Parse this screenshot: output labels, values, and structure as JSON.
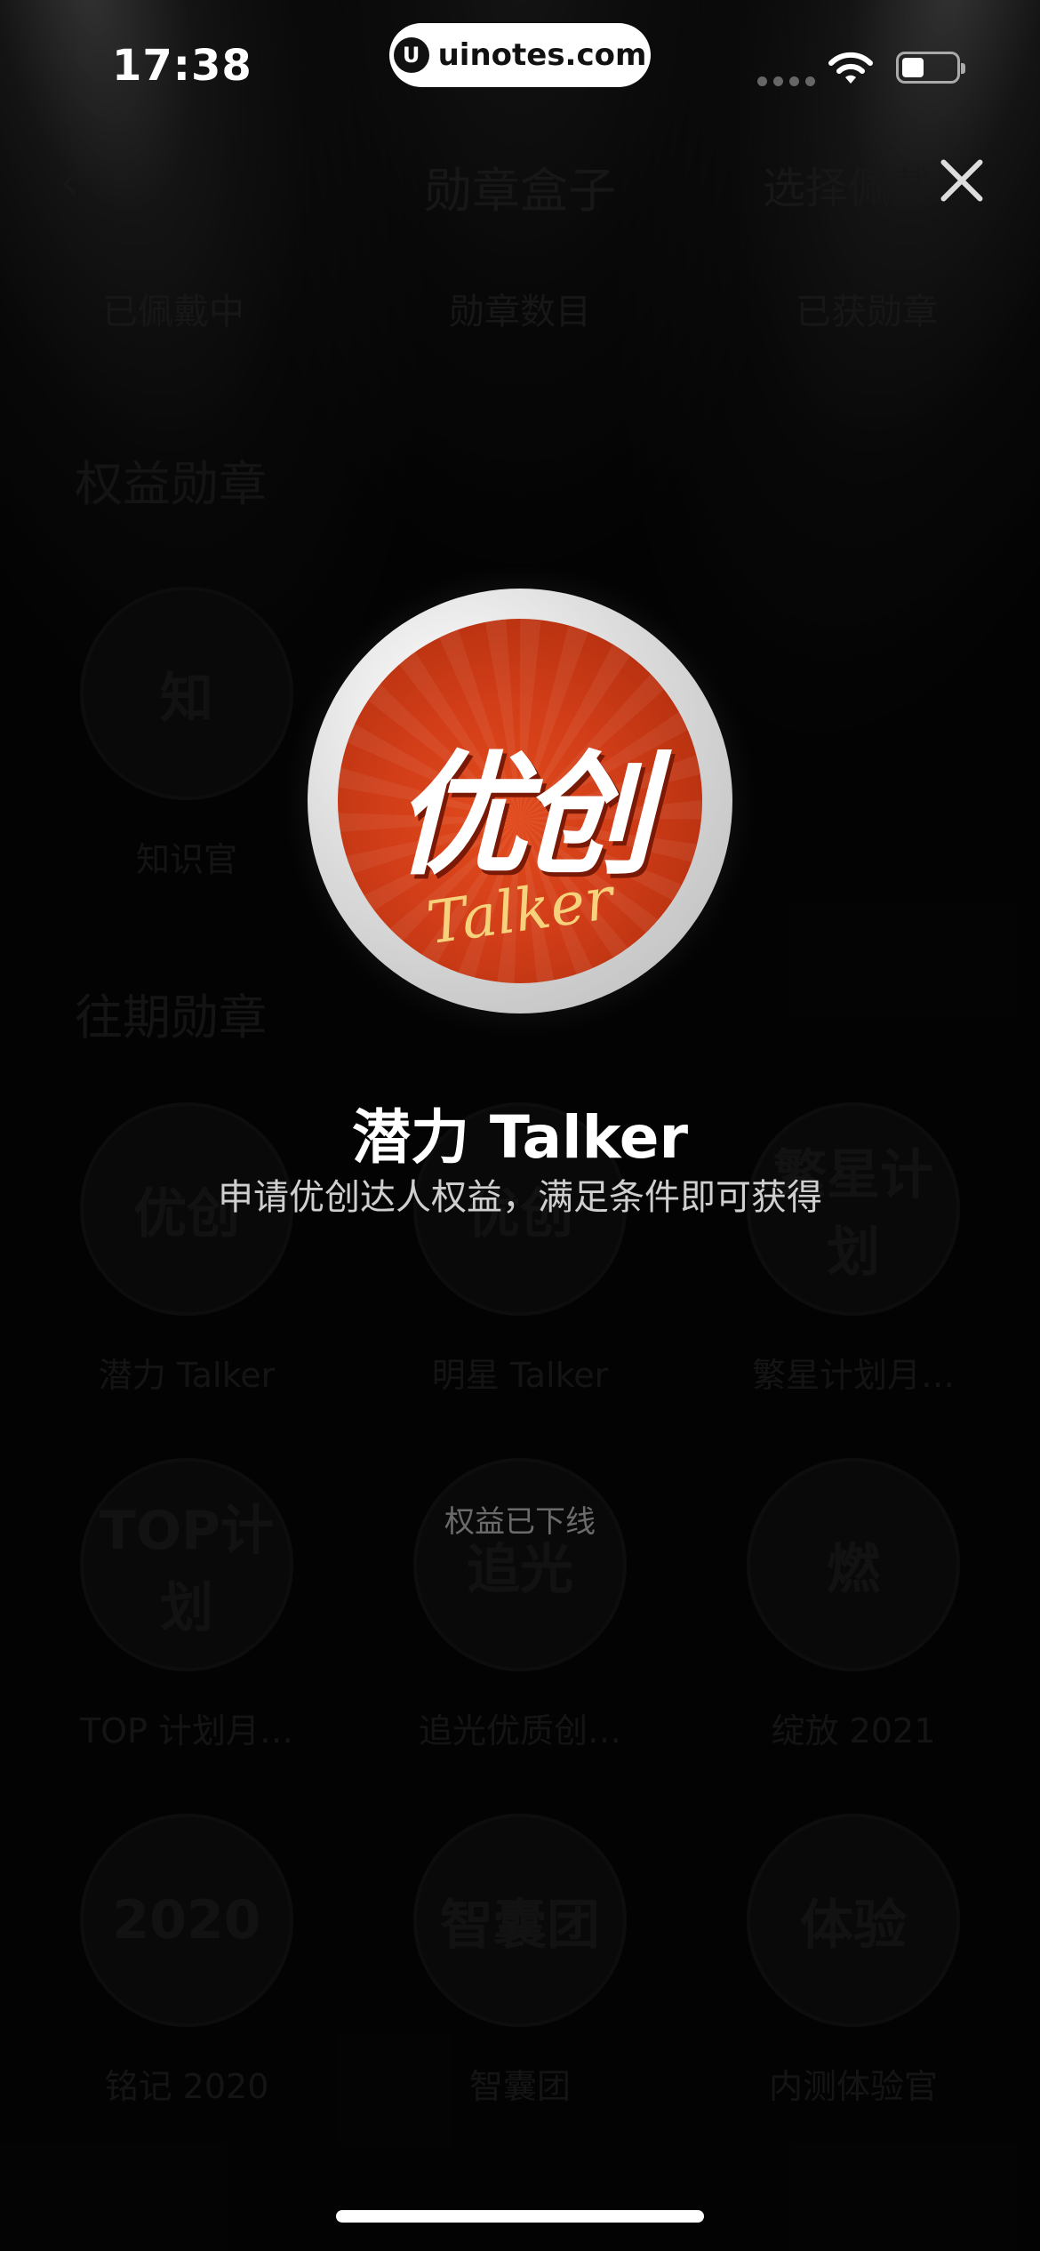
{
  "status_bar": {
    "time": "17:38",
    "url": "uinotes.com",
    "url_logo": "U"
  },
  "background_page": {
    "nav": {
      "back_icon": "‹",
      "title": "勋章盒子",
      "right_action": "选择佩戴"
    },
    "stats": [
      "已佩戴中",
      "勋章数目",
      "已获勋章"
    ],
    "sections": {
      "rights": "权益勋章",
      "past": "往期勋章"
    },
    "rights_badges": [
      {
        "label": "知识官",
        "mark": "知"
      }
    ],
    "past_badges": [
      {
        "label": "潜力 Talker",
        "mark": "优创"
      },
      {
        "label": "明星 Talker",
        "mark": "优创"
      },
      {
        "label": "繁星计划月…",
        "mark": "繁星计划"
      },
      {
        "label": "TOP 计划月…",
        "mark": "TOP计划"
      },
      {
        "label": "追光优质创…",
        "mark": "追光"
      },
      {
        "label": "绽放 2021",
        "mark": "燃"
      },
      {
        "label": "铭记 2020",
        "mark": "2020"
      },
      {
        "label": "智囊团",
        "mark": "智囊团"
      },
      {
        "label": "内测体验官",
        "mark": "体验"
      }
    ]
  },
  "modal": {
    "close_icon": "close-icon",
    "medal_main_text": "优创",
    "medal_sub_text": "Talker",
    "badge_name": "潜力 Talker",
    "badge_desc": "申请优创达人权益，满足条件即可获得",
    "badge_status": "权益已下线"
  },
  "colors": {
    "medal_red": "#d23e18",
    "medal_gold": "#f7d27c"
  }
}
